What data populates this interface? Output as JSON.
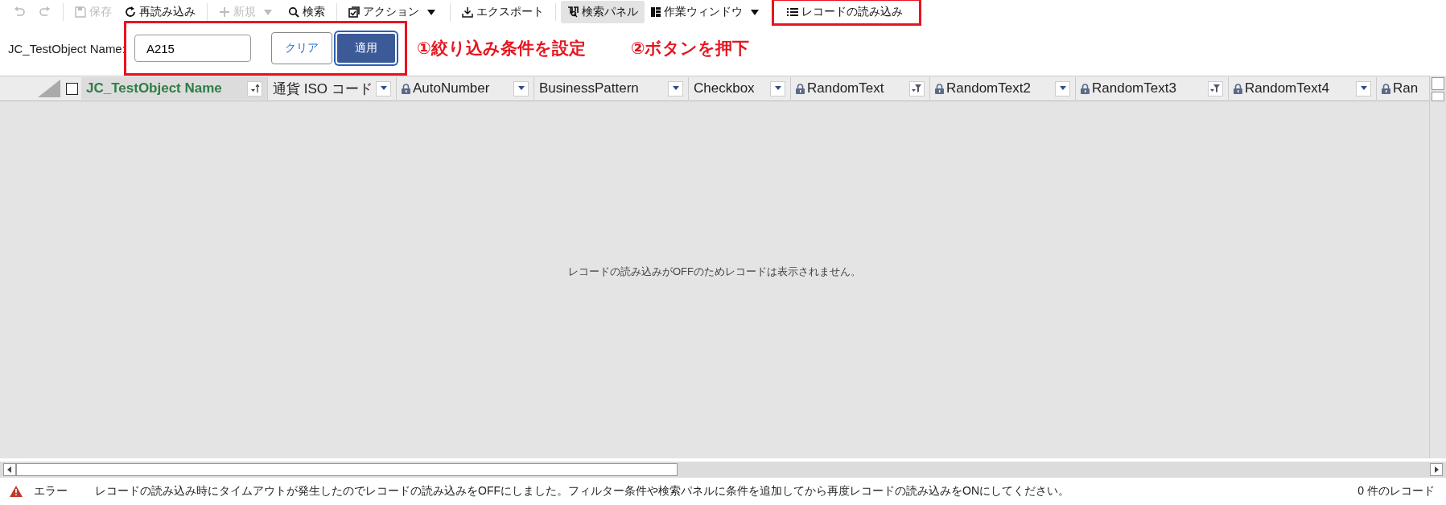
{
  "toolbar": [
    {
      "kind": "undo",
      "disabled": true
    },
    {
      "kind": "redo",
      "disabled": true
    },
    {
      "kind": "separator"
    },
    {
      "kind": "save",
      "label": "保存",
      "disabled": true
    },
    {
      "kind": "reload",
      "label": "再読み込み",
      "disabled": false
    },
    {
      "kind": "separator"
    },
    {
      "kind": "new",
      "label": "新規",
      "disabled": true,
      "dropdown": true
    },
    {
      "kind": "search",
      "label": "検索",
      "disabled": false
    },
    {
      "kind": "separator"
    },
    {
      "kind": "action",
      "label": "アクション",
      "disabled": false,
      "dropdown": true
    },
    {
      "kind": "separator"
    },
    {
      "kind": "export",
      "label": "エクスポート",
      "disabled": false
    },
    {
      "kind": "separator"
    },
    {
      "kind": "panel",
      "label": "検索パネル",
      "disabled": false,
      "selected": true
    },
    {
      "kind": "window",
      "label": "作業ウィンドウ",
      "disabled": false,
      "dropdown": true
    },
    {
      "kind": "list",
      "label": "レコードの読み込み",
      "disabled": false,
      "highlighted": true
    }
  ],
  "filter": {
    "label": "JC_TestObject Name:",
    "value": "A215",
    "highlighted": true,
    "buttons": [
      {
        "label": "クリア",
        "primary": false
      },
      {
        "label": "適用",
        "primary": true
      }
    ]
  },
  "annotations": [
    {
      "text": "①絞り込み条件を設定"
    },
    {
      "text": "②ボタンを押下"
    }
  ],
  "grid": {
    "columns": [
      {
        "name": "JC_TestObject Name",
        "locked": false,
        "active": true,
        "kind": "sort"
      },
      {
        "name": "通貨 ISO コード",
        "locked": false,
        "active": false,
        "kind": "dropdown"
      },
      {
        "name": "AutoNumber",
        "locked": true,
        "active": false,
        "kind": "dropdown"
      },
      {
        "name": "BusinessPattern",
        "locked": false,
        "active": false,
        "kind": "dropdown"
      },
      {
        "name": "Checkbox",
        "locked": false,
        "active": false,
        "kind": "dropdown"
      },
      {
        "name": "RandomText",
        "locked": true,
        "active": false,
        "kind": "filter"
      },
      {
        "name": "RandomText2",
        "locked": true,
        "active": false,
        "kind": "dropdown"
      },
      {
        "name": "RandomText3",
        "locked": true,
        "active": false,
        "kind": "filter"
      },
      {
        "name": "RandomText4",
        "locked": true,
        "active": false,
        "kind": "dropdown"
      },
      {
        "name": "Ran",
        "locked": true,
        "active": false,
        "kind": "plain"
      }
    ],
    "select_all_checked": false,
    "empty_message": "レコードの読み込みがOFFのためレコードは表示されません。"
  },
  "status_bar": {
    "level": "エラー",
    "message": "レコードの読み込み時にタイムアウトが発生したのでレコードの読み込みをOFFにしました。フィルター条件や検索パネルに条件を追加してから再度レコードの読み込みをONにしてください。",
    "count": "0 件のレコード"
  }
}
